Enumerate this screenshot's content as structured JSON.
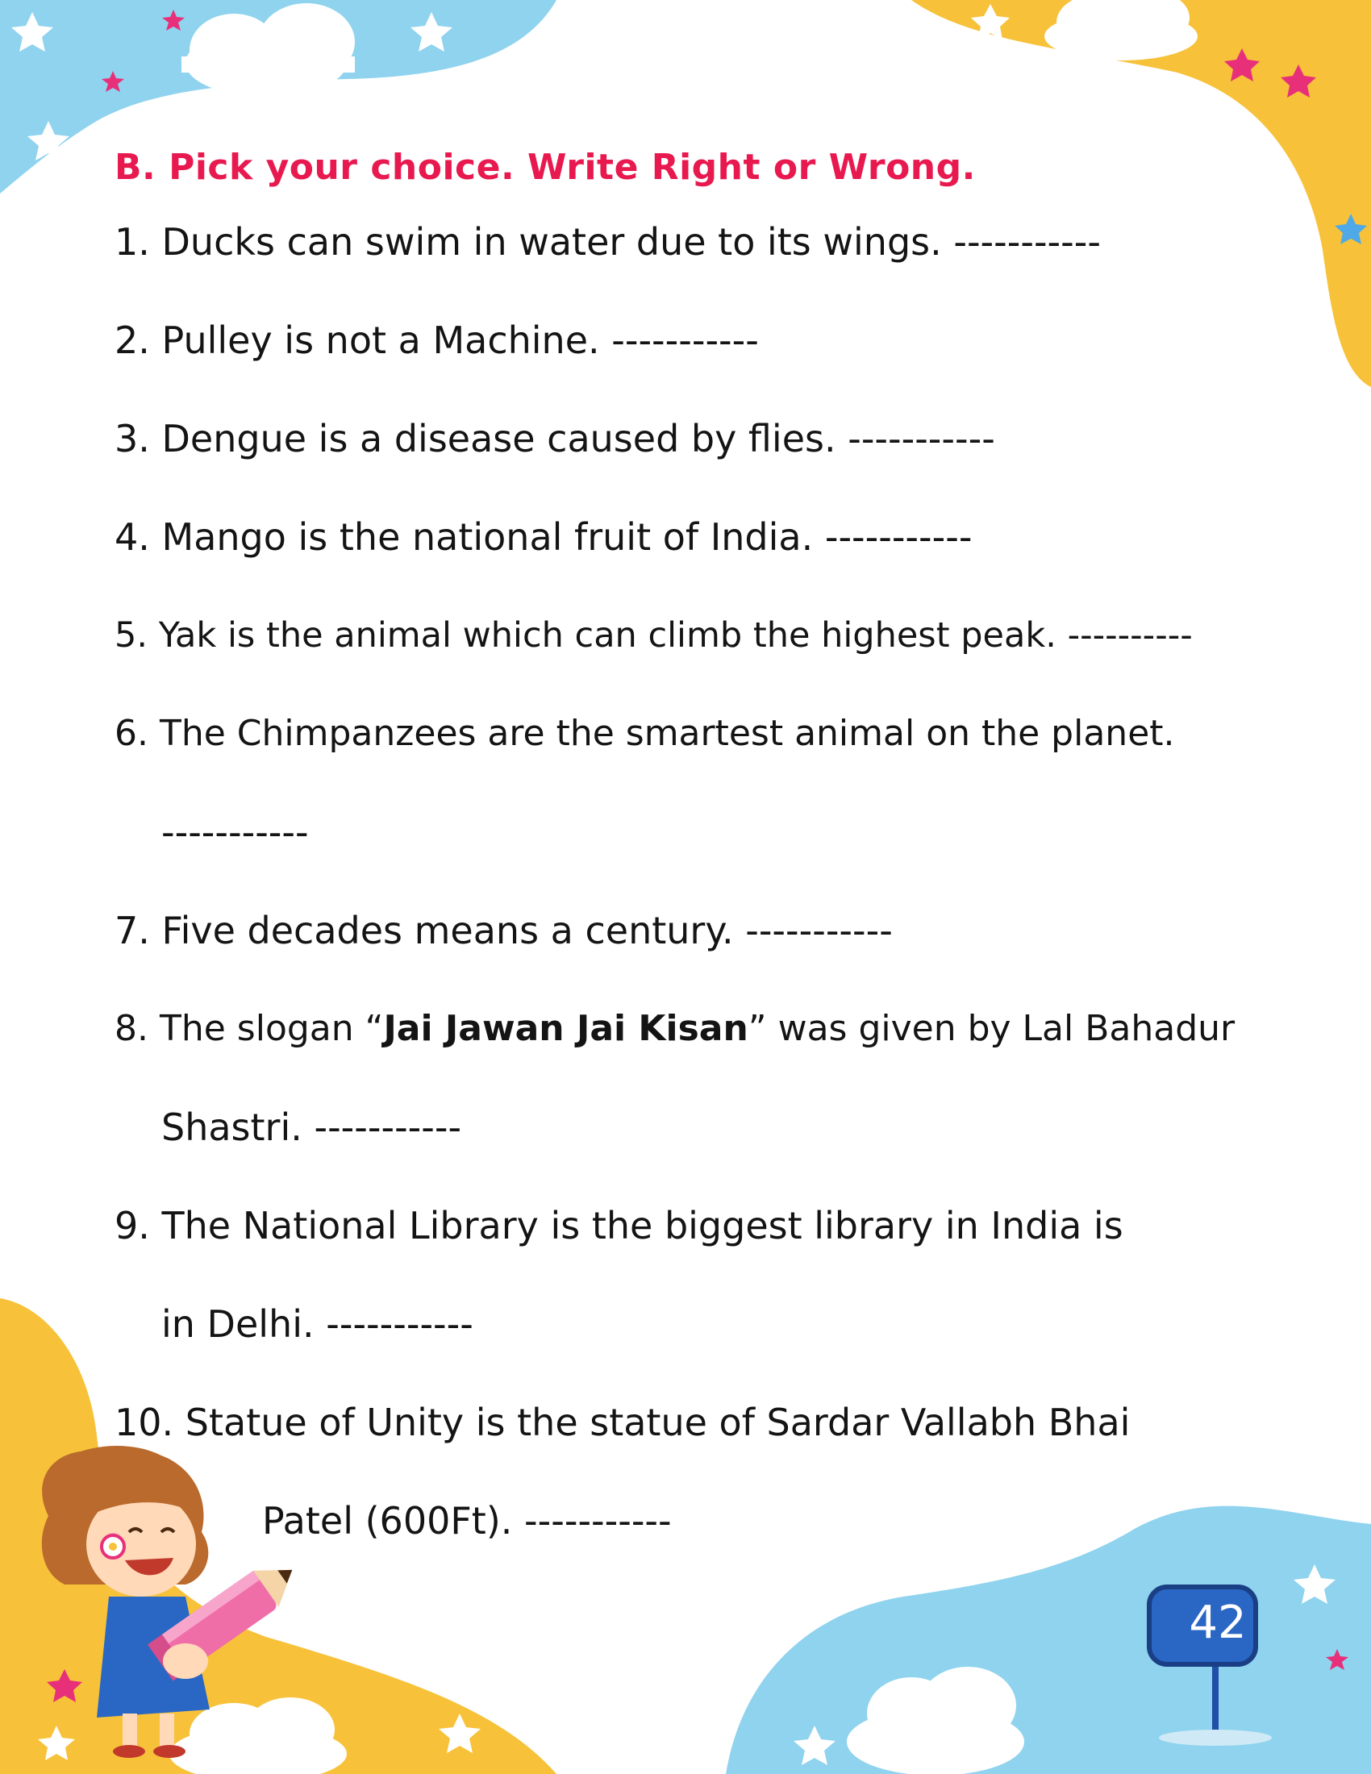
{
  "worksheet": {
    "title": "B. Pick your choice. Write Right or Wrong.",
    "questions": [
      {
        "num": "1.",
        "text": "Ducks can swim in water due to its wings.",
        "blank": "-----------"
      },
      {
        "num": "2.",
        "text": "Pulley is not a Machine.",
        "blank": "-----------"
      },
      {
        "num": "3.",
        "text": "Dengue is a disease caused by flies.",
        "blank": "-----------"
      },
      {
        "num": "4.",
        "text": "Mango is the national fruit of India.",
        "blank": "-----------"
      },
      {
        "num": "5.",
        "text": "Yak is the animal which can climb the highest peak.",
        "blank": "----------"
      },
      {
        "num": "6.",
        "text": "The Chimpanzees are the smartest animal on the planet.",
        "blank": "-----------"
      },
      {
        "num": "7.",
        "text": "Five decades means a century.",
        "blank": "-----------"
      },
      {
        "num": "8.",
        "text_before": "The slogan “",
        "bold": "Jai Jawan Jai Kisan",
        "text_after": "” was given by Lal Bahadur",
        "text_cont": "Shastri.",
        "blank": "-----------"
      },
      {
        "num": "9.",
        "text": "The National Library is the biggest library in India is",
        "text_cont": "in Delhi.",
        "blank": "-----------"
      },
      {
        "num": "10.",
        "text": "Statue of Unity is the statue of Sardar Vallabh Bhai",
        "text_cont": "Patel (600Ft).",
        "blank": "-----------"
      }
    ]
  },
  "page_number": "42",
  "colors": {
    "title": "#e8194f",
    "text": "#141414",
    "sky_blue": "#8fd3ee",
    "yellow": "#f7c23a",
    "sign_blue": "#1f4fa8",
    "pink_star": "#e8307a"
  },
  "decorations": [
    "cloud-icon",
    "star-icon",
    "girl-with-pencil-illustration",
    "page-number-sign"
  ]
}
